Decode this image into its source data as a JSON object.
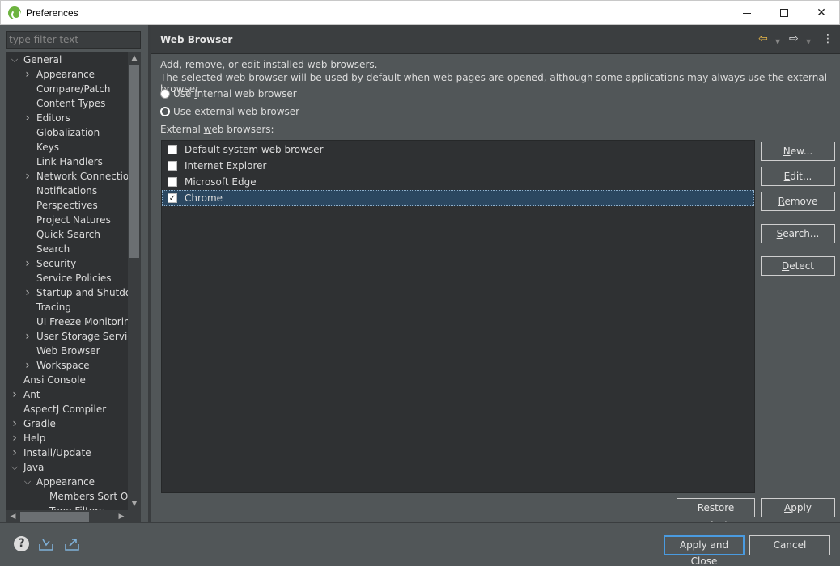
{
  "window": {
    "title": "Preferences",
    "minimize": "",
    "maximize": "",
    "close": "✕"
  },
  "sidebar": {
    "filter_placeholder": "type filter text",
    "tree": [
      {
        "label": "General",
        "expanded": true,
        "level": 0
      },
      {
        "label": "Appearance",
        "expandable": true,
        "level": 1
      },
      {
        "label": "Compare/Patch",
        "level": 1
      },
      {
        "label": "Content Types",
        "level": 1
      },
      {
        "label": "Editors",
        "expandable": true,
        "level": 1
      },
      {
        "label": "Globalization",
        "level": 1
      },
      {
        "label": "Keys",
        "level": 1
      },
      {
        "label": "Link Handlers",
        "level": 1
      },
      {
        "label": "Network Connection",
        "expandable": true,
        "level": 1
      },
      {
        "label": "Notifications",
        "level": 1
      },
      {
        "label": "Perspectives",
        "level": 1
      },
      {
        "label": "Project Natures",
        "level": 1
      },
      {
        "label": "Quick Search",
        "level": 1
      },
      {
        "label": "Search",
        "level": 1
      },
      {
        "label": "Security",
        "expandable": true,
        "level": 1
      },
      {
        "label": "Service Policies",
        "level": 1
      },
      {
        "label": "Startup and Shutdow",
        "expandable": true,
        "level": 1
      },
      {
        "label": "Tracing",
        "level": 1
      },
      {
        "label": "UI Freeze Monitoring",
        "level": 1
      },
      {
        "label": "User Storage Service",
        "expandable": true,
        "level": 1
      },
      {
        "label": "Web Browser",
        "level": 1
      },
      {
        "label": "Workspace",
        "expandable": true,
        "level": 1
      },
      {
        "label": "Ansi Console",
        "level": 0
      },
      {
        "label": "Ant",
        "expandable": true,
        "level": 0
      },
      {
        "label": "AspectJ Compiler",
        "level": 0
      },
      {
        "label": "Gradle",
        "expandable": true,
        "level": 0
      },
      {
        "label": "Help",
        "expandable": true,
        "level": 0
      },
      {
        "label": "Install/Update",
        "expandable": true,
        "level": 0
      },
      {
        "label": "Java",
        "expanded": true,
        "level": 0
      },
      {
        "label": "Appearance",
        "expanded": true,
        "level": 1
      },
      {
        "label": "Members Sort Ord",
        "level": 2
      },
      {
        "label": "Type Filters",
        "level": 2
      }
    ]
  },
  "page": {
    "title": "Web Browser",
    "desc_line1": "Add, remove, or edit installed web browsers.",
    "desc_line2": "The selected web browser will be used by default when web pages are opened, although some applications may always use the external browser.",
    "radio_internal_pre": "Use ",
    "radio_internal_key": "i",
    "radio_internal_post": "nternal web browser",
    "radio_external_pre": "Use e",
    "radio_external_key": "x",
    "radio_external_post": "ternal web browser",
    "list_label_pre": "External ",
    "list_label_key": "w",
    "list_label_post": "eb browsers:",
    "browsers": [
      {
        "label": "Default system web browser",
        "checked": false,
        "selected": false
      },
      {
        "label": "Internet Explorer",
        "checked": false,
        "selected": false
      },
      {
        "label": "Microsoft Edge",
        "checked": false,
        "selected": false
      },
      {
        "label": "Chrome",
        "checked": true,
        "selected": true
      }
    ],
    "buttons": {
      "new_key": "N",
      "new_rest": "ew...",
      "edit_key": "E",
      "edit_rest": "dit...",
      "remove_key": "R",
      "remove_rest": "emove",
      "search_key": "S",
      "search_rest": "earch...",
      "detect_key": "D",
      "detect_rest": "etect",
      "restore_pre": "Restore ",
      "restore_key": "D",
      "restore_post": "efaults",
      "apply_key": "A",
      "apply_rest": "pply"
    }
  },
  "footer": {
    "apply_close": "Apply and Close",
    "cancel": "Cancel",
    "help_glyph": "?"
  },
  "colors": {
    "background": "#515658",
    "tree_background": "#2f3133",
    "selection": "#2b4760",
    "focus_border": "#4a9be0",
    "back_arrow": "#e8b84a"
  }
}
